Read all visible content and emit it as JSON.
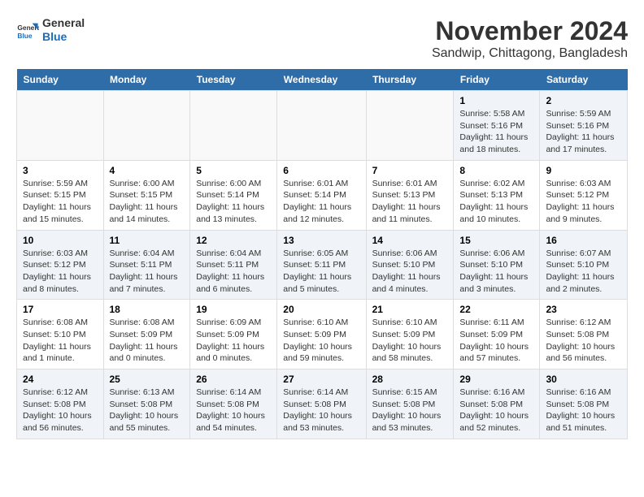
{
  "logo": {
    "general": "General",
    "blue": "Blue"
  },
  "title": {
    "month_year": "November 2024",
    "location": "Sandwip, Chittagong, Bangladesh"
  },
  "headers": [
    "Sunday",
    "Monday",
    "Tuesday",
    "Wednesday",
    "Thursday",
    "Friday",
    "Saturday"
  ],
  "weeks": [
    [
      {
        "day": "",
        "info": ""
      },
      {
        "day": "",
        "info": ""
      },
      {
        "day": "",
        "info": ""
      },
      {
        "day": "",
        "info": ""
      },
      {
        "day": "",
        "info": ""
      },
      {
        "day": "1",
        "info": "Sunrise: 5:58 AM\nSunset: 5:16 PM\nDaylight: 11 hours and 18 minutes."
      },
      {
        "day": "2",
        "info": "Sunrise: 5:59 AM\nSunset: 5:16 PM\nDaylight: 11 hours and 17 minutes."
      }
    ],
    [
      {
        "day": "3",
        "info": "Sunrise: 5:59 AM\nSunset: 5:15 PM\nDaylight: 11 hours and 15 minutes."
      },
      {
        "day": "4",
        "info": "Sunrise: 6:00 AM\nSunset: 5:15 PM\nDaylight: 11 hours and 14 minutes."
      },
      {
        "day": "5",
        "info": "Sunrise: 6:00 AM\nSunset: 5:14 PM\nDaylight: 11 hours and 13 minutes."
      },
      {
        "day": "6",
        "info": "Sunrise: 6:01 AM\nSunset: 5:14 PM\nDaylight: 11 hours and 12 minutes."
      },
      {
        "day": "7",
        "info": "Sunrise: 6:01 AM\nSunset: 5:13 PM\nDaylight: 11 hours and 11 minutes."
      },
      {
        "day": "8",
        "info": "Sunrise: 6:02 AM\nSunset: 5:13 PM\nDaylight: 11 hours and 10 minutes."
      },
      {
        "day": "9",
        "info": "Sunrise: 6:03 AM\nSunset: 5:12 PM\nDaylight: 11 hours and 9 minutes."
      }
    ],
    [
      {
        "day": "10",
        "info": "Sunrise: 6:03 AM\nSunset: 5:12 PM\nDaylight: 11 hours and 8 minutes."
      },
      {
        "day": "11",
        "info": "Sunrise: 6:04 AM\nSunset: 5:11 PM\nDaylight: 11 hours and 7 minutes."
      },
      {
        "day": "12",
        "info": "Sunrise: 6:04 AM\nSunset: 5:11 PM\nDaylight: 11 hours and 6 minutes."
      },
      {
        "day": "13",
        "info": "Sunrise: 6:05 AM\nSunset: 5:11 PM\nDaylight: 11 hours and 5 minutes."
      },
      {
        "day": "14",
        "info": "Sunrise: 6:06 AM\nSunset: 5:10 PM\nDaylight: 11 hours and 4 minutes."
      },
      {
        "day": "15",
        "info": "Sunrise: 6:06 AM\nSunset: 5:10 PM\nDaylight: 11 hours and 3 minutes."
      },
      {
        "day": "16",
        "info": "Sunrise: 6:07 AM\nSunset: 5:10 PM\nDaylight: 11 hours and 2 minutes."
      }
    ],
    [
      {
        "day": "17",
        "info": "Sunrise: 6:08 AM\nSunset: 5:10 PM\nDaylight: 11 hours and 1 minute."
      },
      {
        "day": "18",
        "info": "Sunrise: 6:08 AM\nSunset: 5:09 PM\nDaylight: 11 hours and 0 minutes."
      },
      {
        "day": "19",
        "info": "Sunrise: 6:09 AM\nSunset: 5:09 PM\nDaylight: 11 hours and 0 minutes."
      },
      {
        "day": "20",
        "info": "Sunrise: 6:10 AM\nSunset: 5:09 PM\nDaylight: 10 hours and 59 minutes."
      },
      {
        "day": "21",
        "info": "Sunrise: 6:10 AM\nSunset: 5:09 PM\nDaylight: 10 hours and 58 minutes."
      },
      {
        "day": "22",
        "info": "Sunrise: 6:11 AM\nSunset: 5:09 PM\nDaylight: 10 hours and 57 minutes."
      },
      {
        "day": "23",
        "info": "Sunrise: 6:12 AM\nSunset: 5:08 PM\nDaylight: 10 hours and 56 minutes."
      }
    ],
    [
      {
        "day": "24",
        "info": "Sunrise: 6:12 AM\nSunset: 5:08 PM\nDaylight: 10 hours and 56 minutes."
      },
      {
        "day": "25",
        "info": "Sunrise: 6:13 AM\nSunset: 5:08 PM\nDaylight: 10 hours and 55 minutes."
      },
      {
        "day": "26",
        "info": "Sunrise: 6:14 AM\nSunset: 5:08 PM\nDaylight: 10 hours and 54 minutes."
      },
      {
        "day": "27",
        "info": "Sunrise: 6:14 AM\nSunset: 5:08 PM\nDaylight: 10 hours and 53 minutes."
      },
      {
        "day": "28",
        "info": "Sunrise: 6:15 AM\nSunset: 5:08 PM\nDaylight: 10 hours and 53 minutes."
      },
      {
        "day": "29",
        "info": "Sunrise: 6:16 AM\nSunset: 5:08 PM\nDaylight: 10 hours and 52 minutes."
      },
      {
        "day": "30",
        "info": "Sunrise: 6:16 AM\nSunset: 5:08 PM\nDaylight: 10 hours and 51 minutes."
      }
    ]
  ]
}
